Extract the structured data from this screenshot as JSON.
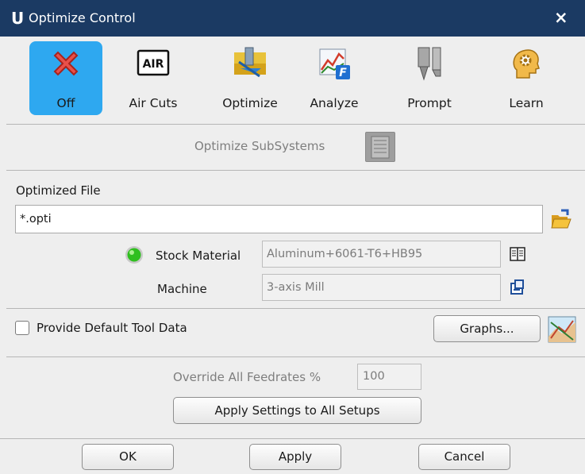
{
  "window": {
    "logo": "U",
    "title": "Optimize Control",
    "close_glyph": "×"
  },
  "toolbar": {
    "items": [
      {
        "label": "Off",
        "icon": "red-x-icon",
        "active": true
      },
      {
        "label": "Air Cuts",
        "icon": "air-icon",
        "icon_text": "AIR"
      },
      {
        "label": "Optimize",
        "icon": "optimize-tool-icon"
      },
      {
        "label": "Analyze",
        "icon": "analyze-chart-icon",
        "icon_text": "F"
      },
      {
        "label": "Prompt",
        "icon": "prompt-tool-icon"
      },
      {
        "label": "Learn",
        "icon": "learn-head-gear-icon"
      }
    ]
  },
  "subsystems": {
    "label": "Optimize SubSystems",
    "icon": "list-document-icon"
  },
  "optimized_file": {
    "label": "Optimized File",
    "value": "*.opti",
    "browse_icon": "open-folder-icon"
  },
  "stock_material": {
    "label": "Stock Material",
    "value": "Aluminum+6061-T6+HB95",
    "status_icon": "green-status-light-icon",
    "library_icon": "book-icon"
  },
  "machine": {
    "label": "Machine",
    "value": "3-axis Mill",
    "edit_icon": "machine-config-icon"
  },
  "default_tool": {
    "label": "Provide Default Tool Data",
    "checked": false
  },
  "graphs": {
    "label": "Graphs...",
    "icon": "graph-image-icon"
  },
  "override": {
    "label": "Override All Feedrates %",
    "value": "100"
  },
  "apply_all": {
    "label": "Apply Settings to All Setups"
  },
  "footer": {
    "ok": "OK",
    "apply": "Apply",
    "cancel": "Cancel"
  },
  "colors": {
    "titlebar": "#1b3a63",
    "active_tool": "#2ea8f0",
    "status_light": "#2fbf1f"
  }
}
